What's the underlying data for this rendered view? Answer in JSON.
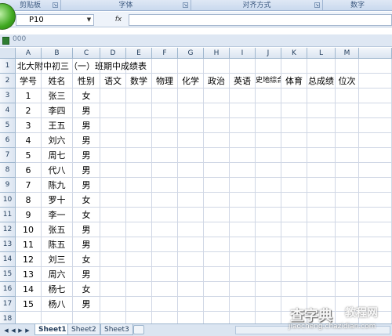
{
  "ribbon": {
    "groups": [
      {
        "label": "剪贴板"
      },
      {
        "label": "字体"
      },
      {
        "label": "对齐方式"
      },
      {
        "label": "数字"
      }
    ]
  },
  "formula_bar": {
    "name_box": "P10",
    "fx_label": "fx",
    "formula": ""
  },
  "document": {
    "title": "000"
  },
  "columns": [
    "A",
    "B",
    "C",
    "D",
    "E",
    "F",
    "G",
    "H",
    "I",
    "J",
    "K",
    "L",
    "M"
  ],
  "rows": [
    "1",
    "2",
    "3",
    "4",
    "5",
    "6",
    "7",
    "8",
    "9",
    "10",
    "11",
    "12",
    "13",
    "14",
    "15",
    "16",
    "17",
    "18"
  ],
  "sheet": {
    "title": "北大附中初三（一）班期中成绩表",
    "headers": [
      "学号",
      "姓名",
      "性别",
      "语文",
      "数学",
      "物理",
      "化学",
      "政治",
      "英语",
      "史地综合",
      "体育",
      "总成绩",
      "位次"
    ],
    "students": [
      {
        "id": "1",
        "name": "张三",
        "gender": "女"
      },
      {
        "id": "2",
        "name": "李四",
        "gender": "男"
      },
      {
        "id": "3",
        "name": "王五",
        "gender": "男"
      },
      {
        "id": "4",
        "name": "刘六",
        "gender": "男"
      },
      {
        "id": "5",
        "name": "周七",
        "gender": "男"
      },
      {
        "id": "6",
        "name": "代八",
        "gender": "男"
      },
      {
        "id": "7",
        "name": "陈九",
        "gender": "男"
      },
      {
        "id": "8",
        "name": "罗十",
        "gender": "女"
      },
      {
        "id": "9",
        "name": "李一",
        "gender": "女"
      },
      {
        "id": "10",
        "name": "张五",
        "gender": "男"
      },
      {
        "id": "11",
        "name": "陈五",
        "gender": "男"
      },
      {
        "id": "12",
        "name": "刘三",
        "gender": "女"
      },
      {
        "id": "13",
        "name": "周六",
        "gender": "男"
      },
      {
        "id": "14",
        "name": "杨七",
        "gender": "女"
      },
      {
        "id": "15",
        "name": "杨八",
        "gender": "男"
      }
    ]
  },
  "sheet_tabs": [
    "Sheet1",
    "Sheet2",
    "Sheet3"
  ],
  "watermark": {
    "line1": "查字典",
    "line2": "jiaocheng.chazidian.com",
    "line3": "教程网"
  }
}
